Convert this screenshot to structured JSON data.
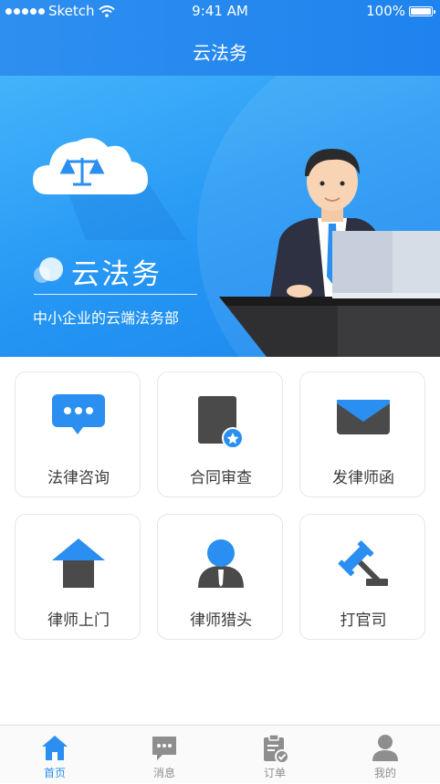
{
  "status": {
    "carrier": "Sketch",
    "time": "9:41 AM",
    "battery": "100%"
  },
  "nav": {
    "title": "云法务"
  },
  "banner": {
    "title": "云法务",
    "subtitle": "中小企业的云端法务部"
  },
  "services": [
    {
      "label": "法律咨询",
      "icon": "chat-bubble-icon"
    },
    {
      "label": "合同审查",
      "icon": "contract-icon"
    },
    {
      "label": "发律师函",
      "icon": "envelope-icon"
    },
    {
      "label": "律师上门",
      "icon": "house-icon"
    },
    {
      "label": "律师猎头",
      "icon": "lawyer-icon"
    },
    {
      "label": "打官司",
      "icon": "gavel-icon"
    }
  ],
  "tabs": [
    {
      "label": "首页",
      "icon": "home-icon",
      "active": true
    },
    {
      "label": "消息",
      "icon": "message-icon",
      "active": false
    },
    {
      "label": "订单",
      "icon": "order-icon",
      "active": false
    },
    {
      "label": "我的",
      "icon": "profile-icon",
      "active": false
    }
  ],
  "colors": {
    "primary": "#2a8ff0",
    "dark_icon": "#4a4a4a",
    "text": "#3a3a3a",
    "tab_inactive": "#8e8e8e"
  }
}
